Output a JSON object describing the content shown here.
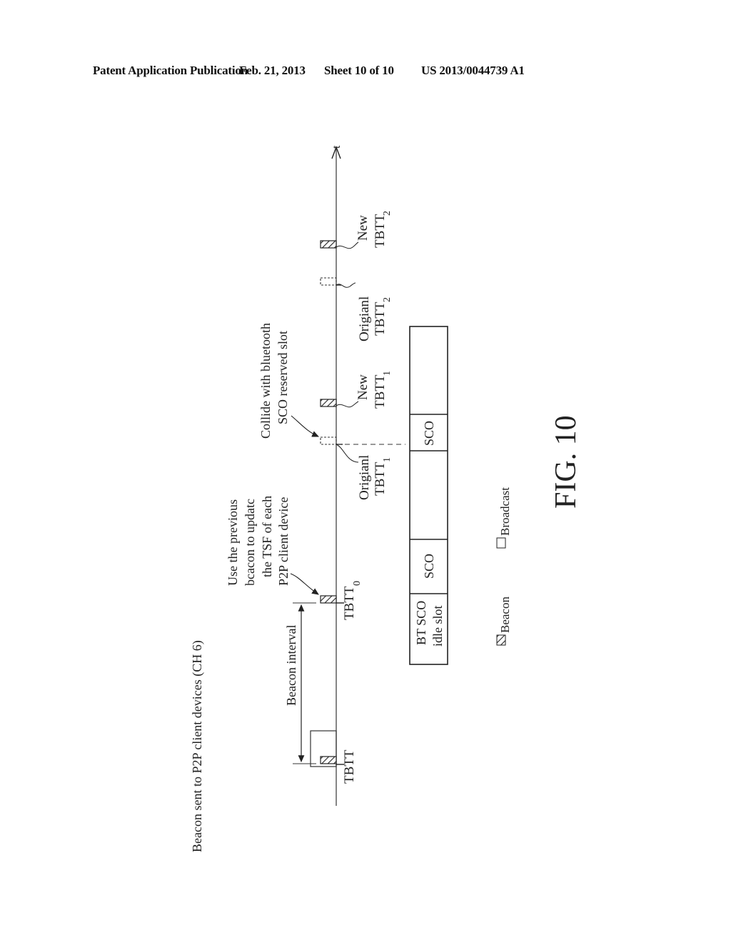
{
  "header": {
    "publication": "Patent Application Publication",
    "date": "Feb. 21, 2013",
    "sheet": "Sheet 10 of 10",
    "number": "US 2013/0044739 A1"
  },
  "figure": {
    "caption": "FIG. 10",
    "title": "Beacon sent to P2P client devices (CH 6)",
    "time_axis_label": "t",
    "beacon_interval_label": "Beacon interval",
    "annotation_update": [
      "Use the previous",
      "bcacon to updatc",
      "the TSF of each",
      "P2P client device"
    ],
    "annotation_collide": [
      "Collide with bluetooth",
      "SCO reserved slot"
    ],
    "tbtt_labels": [
      {
        "id": "tbtt",
        "main": "TBTT",
        "sub": ""
      },
      {
        "id": "tbtt0",
        "main": "TBTT",
        "sub": "0"
      },
      {
        "id": "orig1",
        "prefix": "Origianl",
        "main": "TBTT",
        "sub": "1"
      },
      {
        "id": "new1",
        "prefix": "New",
        "main": "TBTT",
        "sub": "1"
      },
      {
        "id": "orig2",
        "prefix": "Origianl",
        "main": "TBTT",
        "sub": "2"
      },
      {
        "id": "new2",
        "prefix": "New",
        "main": "TBTT",
        "sub": "2"
      }
    ],
    "bt_slots": [
      "BT SCO idle slot",
      "SCO",
      "",
      "SCO",
      ""
    ],
    "bt_idle_line1": "BT SCO",
    "bt_idle_line2": "idle slot",
    "legend": {
      "beacon": "Beacon",
      "broadcast": "Broadcast"
    }
  }
}
